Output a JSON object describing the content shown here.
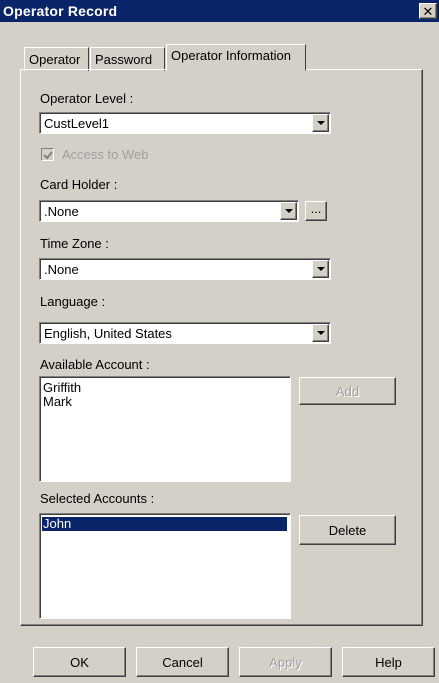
{
  "window": {
    "title": "Operator Record",
    "close_glyph": "✕"
  },
  "tabs": [
    {
      "label": "Operator",
      "active": false
    },
    {
      "label": "Password",
      "active": false
    },
    {
      "label": "Operator Information",
      "active": true
    }
  ],
  "form": {
    "operator_level": {
      "label": "Operator Level :",
      "value": "CustLevel1"
    },
    "access_to_web": {
      "label": "Access to Web",
      "checked": true,
      "enabled": false
    },
    "card_holder": {
      "label": "Card Holder :",
      "value": ".None",
      "browse_label": "..."
    },
    "time_zone": {
      "label": "Time Zone :",
      "value": ".None"
    },
    "language": {
      "label": "Language :",
      "value": "English, United States"
    },
    "available_account": {
      "label": "Available Account :",
      "items": [
        "Griffith",
        "Mark"
      ],
      "add_label": "Add",
      "add_enabled": false
    },
    "selected_accounts": {
      "label": "Selected Accounts :",
      "items": [
        "John"
      ],
      "selected_index": 0,
      "delete_label": "Delete"
    }
  },
  "footer": {
    "ok_label": "OK",
    "cancel_label": "Cancel",
    "apply_label": "Apply",
    "apply_enabled": false,
    "help_label": "Help"
  },
  "colors": {
    "titlebar": "#0a246a",
    "face": "#d4d0c8",
    "selection": "#0a246a"
  }
}
